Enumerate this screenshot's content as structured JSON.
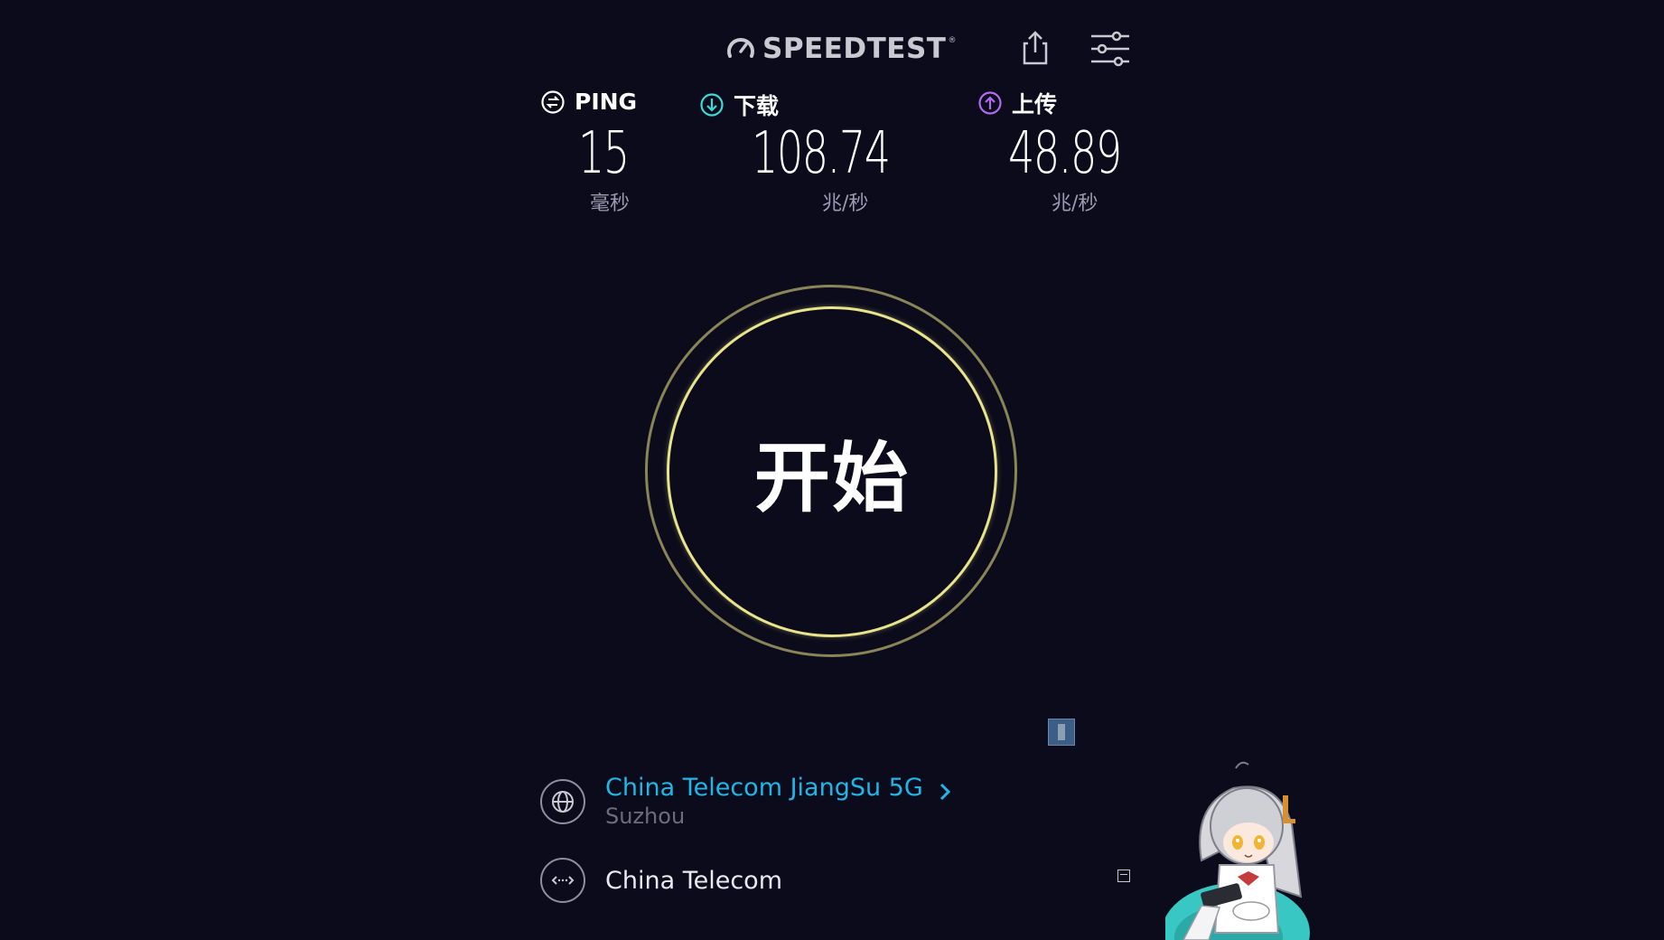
{
  "header": {
    "logo_text": "SPEEDTEST",
    "logo_tm": "®",
    "share_icon": "share-icon",
    "settings_icon": "sliders-icon"
  },
  "metrics": {
    "ping": {
      "label": "PING",
      "value": "15",
      "unit": "毫秒",
      "icon": "ping-icon",
      "color": "#ffffff"
    },
    "download": {
      "label": "下载",
      "value": "108.74",
      "unit": "兆/秒",
      "icon": "download-arrow-icon",
      "color": "#3dd9d6"
    },
    "upload": {
      "label": "上传",
      "value": "48.89",
      "unit": "兆/秒",
      "icon": "upload-arrow-icon",
      "color": "#b26af0"
    }
  },
  "go_button": {
    "label": "开始",
    "ring_color": "#e9e48a"
  },
  "server": {
    "name": "China Telecom JiangSu 5G",
    "city": "Suzhou",
    "icon": "globe-icon",
    "link_color": "#1fb6e8"
  },
  "provider": {
    "name": "China Telecom",
    "icon": "connection-icon"
  },
  "colors": {
    "background": "#0b0b1c",
    "unit_text": "#9c9cae"
  }
}
